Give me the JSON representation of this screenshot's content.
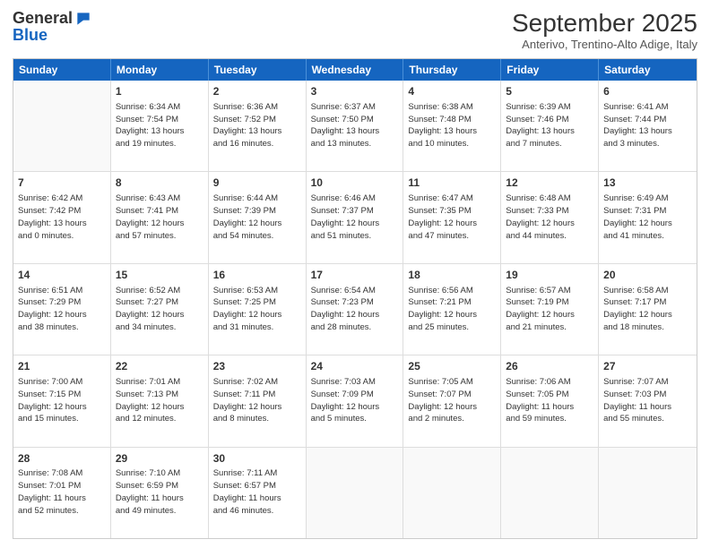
{
  "logo": {
    "general": "General",
    "blue": "Blue"
  },
  "title": "September 2025",
  "subtitle": "Anterivo, Trentino-Alto Adige, Italy",
  "days": [
    "Sunday",
    "Monday",
    "Tuesday",
    "Wednesday",
    "Thursday",
    "Friday",
    "Saturday"
  ],
  "weeks": [
    [
      {
        "day": "",
        "detail": ""
      },
      {
        "day": "1",
        "detail": "Sunrise: 6:34 AM\nSunset: 7:54 PM\nDaylight: 13 hours\nand 19 minutes."
      },
      {
        "day": "2",
        "detail": "Sunrise: 6:36 AM\nSunset: 7:52 PM\nDaylight: 13 hours\nand 16 minutes."
      },
      {
        "day": "3",
        "detail": "Sunrise: 6:37 AM\nSunset: 7:50 PM\nDaylight: 13 hours\nand 13 minutes."
      },
      {
        "day": "4",
        "detail": "Sunrise: 6:38 AM\nSunset: 7:48 PM\nDaylight: 13 hours\nand 10 minutes."
      },
      {
        "day": "5",
        "detail": "Sunrise: 6:39 AM\nSunset: 7:46 PM\nDaylight: 13 hours\nand 7 minutes."
      },
      {
        "day": "6",
        "detail": "Sunrise: 6:41 AM\nSunset: 7:44 PM\nDaylight: 13 hours\nand 3 minutes."
      }
    ],
    [
      {
        "day": "7",
        "detail": "Sunrise: 6:42 AM\nSunset: 7:42 PM\nDaylight: 13 hours\nand 0 minutes."
      },
      {
        "day": "8",
        "detail": "Sunrise: 6:43 AM\nSunset: 7:41 PM\nDaylight: 12 hours\nand 57 minutes."
      },
      {
        "day": "9",
        "detail": "Sunrise: 6:44 AM\nSunset: 7:39 PM\nDaylight: 12 hours\nand 54 minutes."
      },
      {
        "day": "10",
        "detail": "Sunrise: 6:46 AM\nSunset: 7:37 PM\nDaylight: 12 hours\nand 51 minutes."
      },
      {
        "day": "11",
        "detail": "Sunrise: 6:47 AM\nSunset: 7:35 PM\nDaylight: 12 hours\nand 47 minutes."
      },
      {
        "day": "12",
        "detail": "Sunrise: 6:48 AM\nSunset: 7:33 PM\nDaylight: 12 hours\nand 44 minutes."
      },
      {
        "day": "13",
        "detail": "Sunrise: 6:49 AM\nSunset: 7:31 PM\nDaylight: 12 hours\nand 41 minutes."
      }
    ],
    [
      {
        "day": "14",
        "detail": "Sunrise: 6:51 AM\nSunset: 7:29 PM\nDaylight: 12 hours\nand 38 minutes."
      },
      {
        "day": "15",
        "detail": "Sunrise: 6:52 AM\nSunset: 7:27 PM\nDaylight: 12 hours\nand 34 minutes."
      },
      {
        "day": "16",
        "detail": "Sunrise: 6:53 AM\nSunset: 7:25 PM\nDaylight: 12 hours\nand 31 minutes."
      },
      {
        "day": "17",
        "detail": "Sunrise: 6:54 AM\nSunset: 7:23 PM\nDaylight: 12 hours\nand 28 minutes."
      },
      {
        "day": "18",
        "detail": "Sunrise: 6:56 AM\nSunset: 7:21 PM\nDaylight: 12 hours\nand 25 minutes."
      },
      {
        "day": "19",
        "detail": "Sunrise: 6:57 AM\nSunset: 7:19 PM\nDaylight: 12 hours\nand 21 minutes."
      },
      {
        "day": "20",
        "detail": "Sunrise: 6:58 AM\nSunset: 7:17 PM\nDaylight: 12 hours\nand 18 minutes."
      }
    ],
    [
      {
        "day": "21",
        "detail": "Sunrise: 7:00 AM\nSunset: 7:15 PM\nDaylight: 12 hours\nand 15 minutes."
      },
      {
        "day": "22",
        "detail": "Sunrise: 7:01 AM\nSunset: 7:13 PM\nDaylight: 12 hours\nand 12 minutes."
      },
      {
        "day": "23",
        "detail": "Sunrise: 7:02 AM\nSunset: 7:11 PM\nDaylight: 12 hours\nand 8 minutes."
      },
      {
        "day": "24",
        "detail": "Sunrise: 7:03 AM\nSunset: 7:09 PM\nDaylight: 12 hours\nand 5 minutes."
      },
      {
        "day": "25",
        "detail": "Sunrise: 7:05 AM\nSunset: 7:07 PM\nDaylight: 12 hours\nand 2 minutes."
      },
      {
        "day": "26",
        "detail": "Sunrise: 7:06 AM\nSunset: 7:05 PM\nDaylight: 11 hours\nand 59 minutes."
      },
      {
        "day": "27",
        "detail": "Sunrise: 7:07 AM\nSunset: 7:03 PM\nDaylight: 11 hours\nand 55 minutes."
      }
    ],
    [
      {
        "day": "28",
        "detail": "Sunrise: 7:08 AM\nSunset: 7:01 PM\nDaylight: 11 hours\nand 52 minutes."
      },
      {
        "day": "29",
        "detail": "Sunrise: 7:10 AM\nSunset: 6:59 PM\nDaylight: 11 hours\nand 49 minutes."
      },
      {
        "day": "30",
        "detail": "Sunrise: 7:11 AM\nSunset: 6:57 PM\nDaylight: 11 hours\nand 46 minutes."
      },
      {
        "day": "",
        "detail": ""
      },
      {
        "day": "",
        "detail": ""
      },
      {
        "day": "",
        "detail": ""
      },
      {
        "day": "",
        "detail": ""
      }
    ]
  ]
}
